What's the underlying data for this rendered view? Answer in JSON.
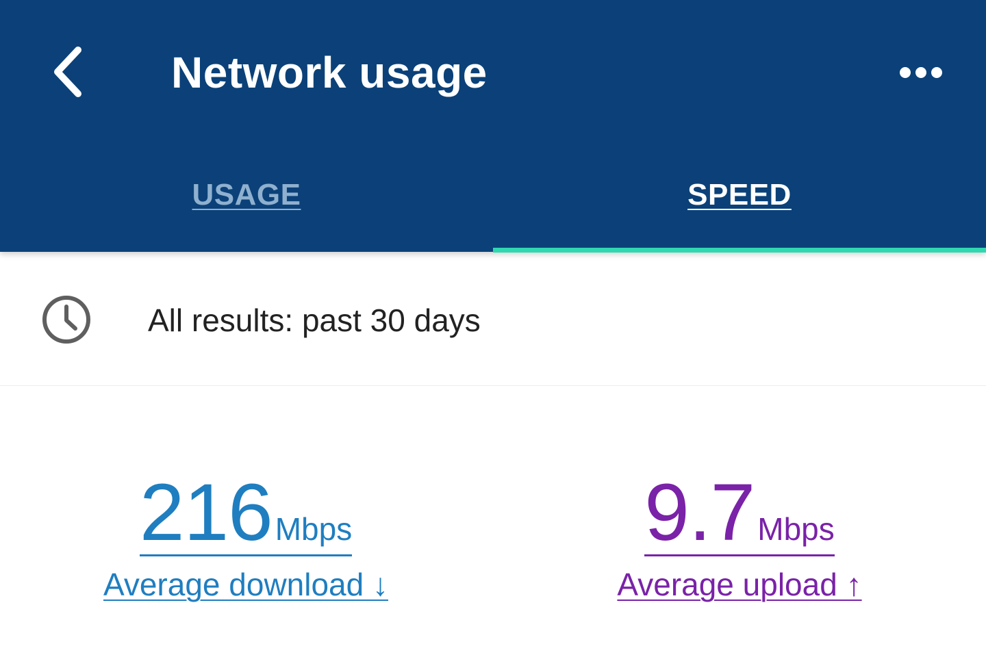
{
  "header": {
    "title": "Network usage",
    "back_icon": "chevron-left-icon",
    "more_icon": "more-horizontal-icon"
  },
  "tabs": [
    {
      "label": "USAGE",
      "selected": false
    },
    {
      "label": "SPEED",
      "selected": true
    }
  ],
  "filter": {
    "icon": "clock-icon",
    "text": "All results: past 30 days"
  },
  "metrics": {
    "download": {
      "value": "216",
      "unit": "Mbps",
      "label": "Average download ↓",
      "color": "#1f7ec0"
    },
    "upload": {
      "value": "9.7",
      "unit": "Mbps",
      "label": "Average upload ↑",
      "color": "#7a22a8"
    }
  },
  "colors": {
    "appbar": "#0b4178",
    "tab_indicator": "#2fd8b0",
    "inactive_tab": "#8fb0cf"
  }
}
